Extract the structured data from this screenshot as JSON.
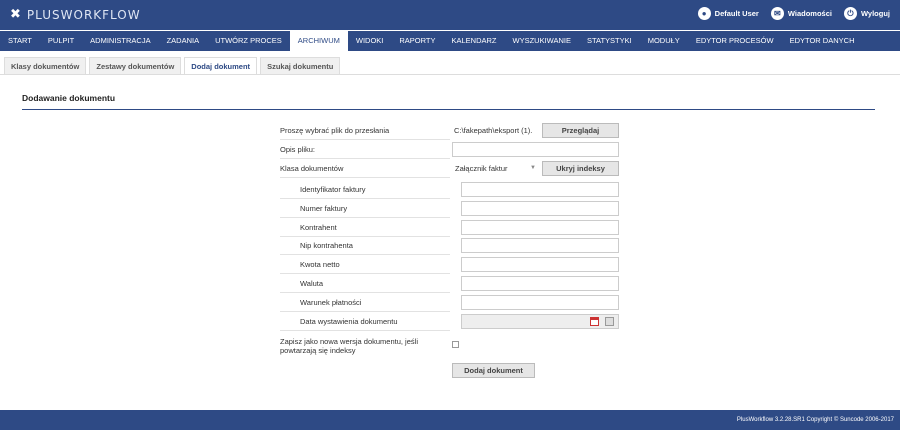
{
  "app": {
    "logo": "PLUSWORKFLOW"
  },
  "user_links": [
    {
      "name": "user",
      "icon": "user-icon",
      "label": "Default User"
    },
    {
      "name": "messages",
      "icon": "mail-icon",
      "label": "Wiadomości"
    },
    {
      "name": "logout",
      "icon": "power-icon",
      "label": "Wyloguj"
    }
  ],
  "nav": {
    "items": [
      "START",
      "PULPIT",
      "ADMINISTRACJA",
      "ZADANIA",
      "UTWÓRZ PROCES",
      "ARCHIWUM",
      "WIDOKI",
      "RAPORTY",
      "KALENDARZ",
      "WYSZUKIWANIE",
      "STATYSTYKI",
      "MODUŁY",
      "EDYTOR PROCESÓW",
      "EDYTOR DANYCH"
    ],
    "active": "ARCHIWUM"
  },
  "subtabs": {
    "items": [
      "Klasy dokumentów",
      "Zestawy dokumentów",
      "Dodaj dokument",
      "Szukaj dokumentu"
    ],
    "active": "Dodaj dokument"
  },
  "section": {
    "title": "Dodawanie dokumentu"
  },
  "form": {
    "file_label": "Proszę wybrać plik do przesłania",
    "file_value": "C:\\fakepath\\eksport (1).",
    "browse_button": "Przeglądaj",
    "desc_label": "Opis pliku:",
    "class_label": "Klasa dokumentów",
    "class_value": "Załącznik faktur",
    "hide_index_button": "Ukryj indeksy",
    "index_fields": [
      "Identyfikator faktury",
      "Numer faktury",
      "Kontrahent",
      "Nip kontrahenta",
      "Kwota netto",
      "Waluta",
      "Warunek płatności",
      "Data wystawienia dokumentu"
    ],
    "version_label": "Zapisz jako nowa wersja dokumentu, jeśli powtarzają się indeksy",
    "submit_button": "Dodaj dokument"
  },
  "footer": {
    "text": "PlusWorkflow 3.2.28.SR1 Copyright © Suncode 2006-2017"
  }
}
